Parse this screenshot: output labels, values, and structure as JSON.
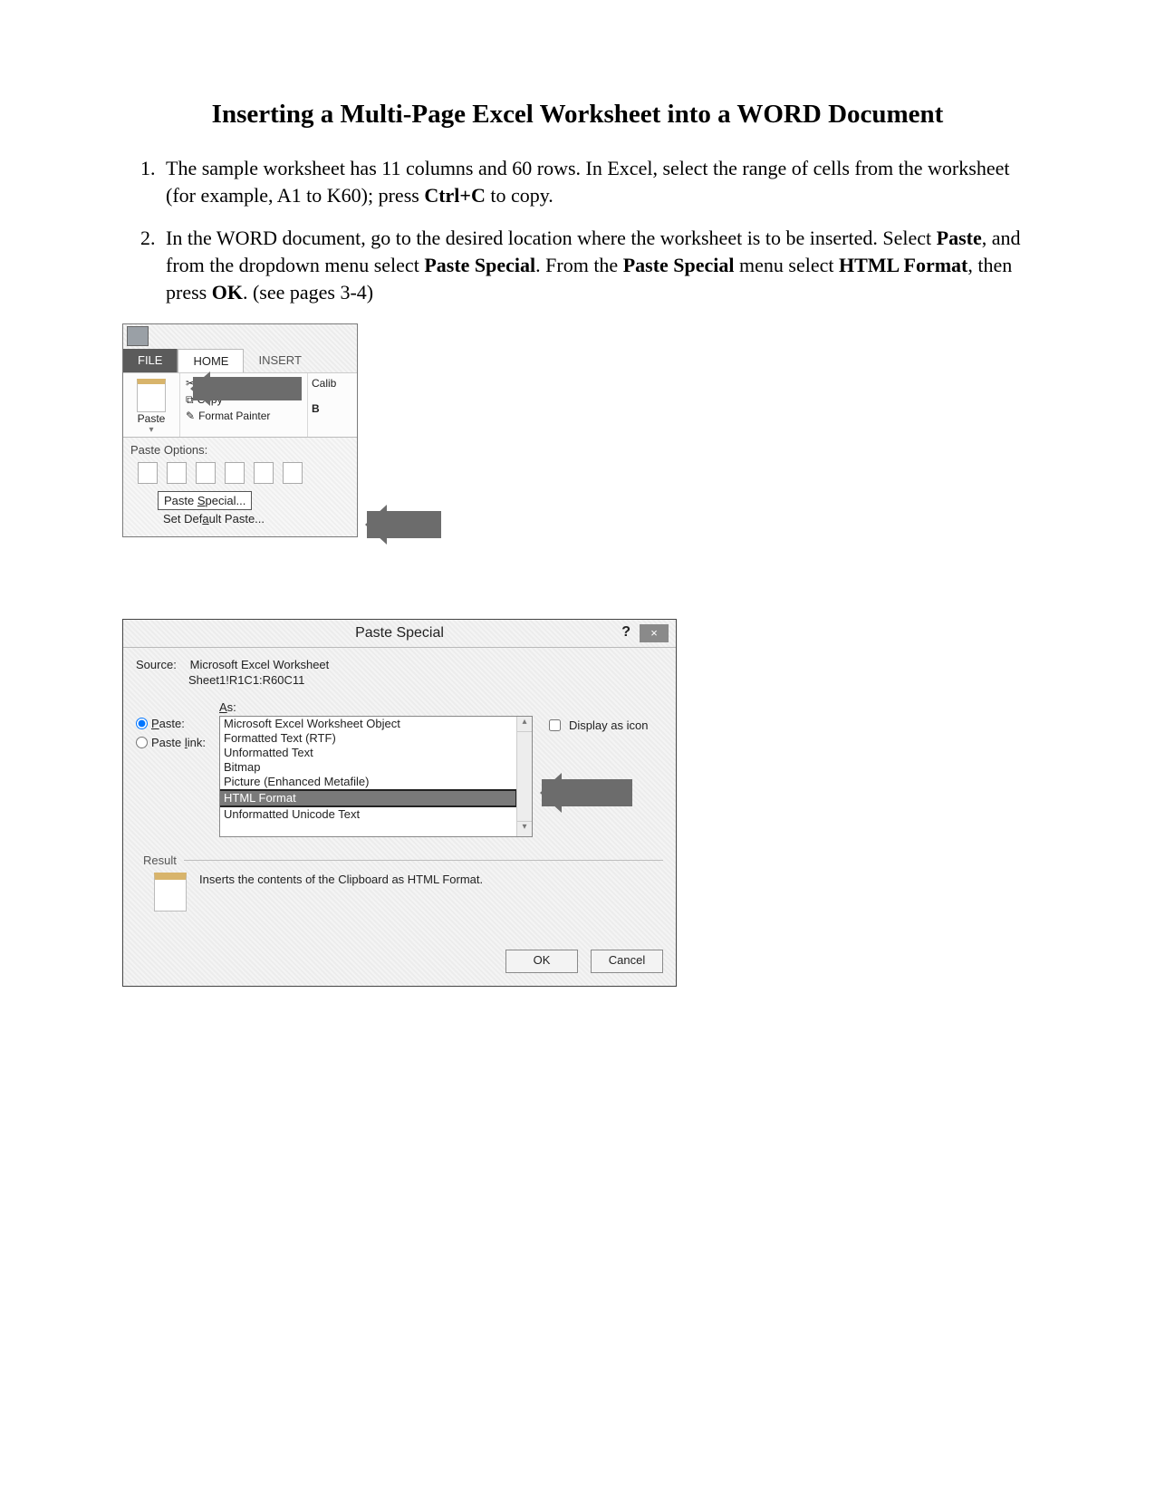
{
  "title": "Inserting a Multi-Page Excel Worksheet into a WORD Document",
  "steps": {
    "s1_a": "The sample worksheet has 11 columns and 60 rows. In Excel, select the range of cells from the worksheet (for example, A1 to K60); press ",
    "s1_b": "Ctrl+C",
    "s1_c": " to copy.",
    "s2_a": "In the WORD document, go to the desired location where the worksheet is to be inserted. Select ",
    "s2_b": "Paste",
    "s2_c": ", and from the dropdown menu select ",
    "s2_d": "Paste Special",
    "s2_e": ". From the ",
    "s2_f": "Paste Special",
    "s2_g": " menu select ",
    "s2_h": "HTML Format",
    "s2_i": ", then press ",
    "s2_j": "OK",
    "s2_k": ". (see pages 3-4)"
  },
  "ribbon": {
    "tabs": {
      "file": "FILE",
      "home": "HOME",
      "insert": "INSERT"
    },
    "paste": "Paste",
    "cut": "Cut",
    "copy": "Copy",
    "fmt_painter": "Format Painter",
    "font_name": "Calib",
    "bold": "B",
    "paste_options": "Paste Options:",
    "paste_special": "Paste Special...",
    "set_default": "Set Default Paste...",
    "ps_underline": "S",
    "sd_underline": "a"
  },
  "dialog": {
    "title": "Paste Special",
    "help": "?",
    "close": "×",
    "source_lbl": "Source:",
    "source_v1": "Microsoft Excel Worksheet",
    "source_v2": "Sheet1!R1C1:R60C11",
    "as_lbl": "As:",
    "paste_lbl": "Paste:",
    "pastelink_lbl": "Paste link:",
    "opts": [
      "Microsoft Excel Worksheet Object",
      "Formatted Text (RTF)",
      "Unformatted Text",
      "Bitmap",
      "Picture (Enhanced Metafile)",
      "HTML Format",
      "Unformatted Unicode Text"
    ],
    "display_icon": "Display as icon",
    "result_lbl": "Result",
    "result_txt": "Inserts the contents of the Clipboard as HTML Format.",
    "ok": "OK",
    "cancel": "Cancel"
  }
}
